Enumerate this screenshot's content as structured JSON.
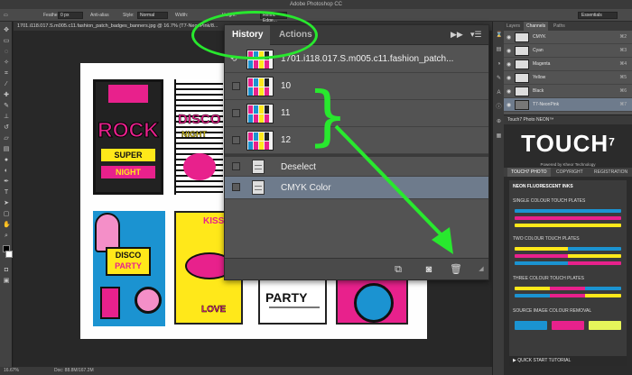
{
  "app": {
    "title": "Adobe Photoshop CC"
  },
  "options_bar": {
    "feather_label": "Feather:",
    "feather_value": "0 px",
    "antialias_label": "Anti-alias",
    "style_label": "Style:",
    "style_value": "Normal",
    "width_label": "Width:",
    "height_label": "Height:",
    "refine_edge_label": "Refine Edge...",
    "workspace": "Essentials"
  },
  "document": {
    "tab_title": "1701.i118.017.S.m005.c11.fashion_patch_badges_banners.jpg @ 16.7% (T7-NeonPink/8..."
  },
  "artwork": {
    "rock": "ROCK",
    "super": "SUPER",
    "night": "NIGHT",
    "disco": "DISCO",
    "disco_night": "NIGHT",
    "disco2": "DISCO",
    "party": "PARTY",
    "kiss": "KISS",
    "love": "LOVE",
    "party_big": "PARTY"
  },
  "history_panel": {
    "tabs": [
      {
        "label": "History"
      },
      {
        "label": "Actions"
      }
    ],
    "collapse_icon": "double-chevron-right-icon",
    "menu_icon": "panel-menu-icon",
    "rows": [
      {
        "label": "1701.i118.017.S.m005.c11.fashion_patch...",
        "kind": "snapshot"
      },
      {
        "label": "10",
        "kind": "snapshot"
      },
      {
        "label": "11",
        "kind": "snapshot"
      },
      {
        "label": "12",
        "kind": "snapshot"
      },
      {
        "label": "Deselect",
        "kind": "state"
      },
      {
        "label": "CMYK Color",
        "kind": "state",
        "selected": true
      }
    ],
    "footer_icons": [
      "new-document-icon",
      "camera-icon",
      "trash-icon"
    ]
  },
  "channels_panel": {
    "tabs": [
      {
        "label": "Layers"
      },
      {
        "label": "Channels"
      },
      {
        "label": "Paths"
      }
    ],
    "rows": [
      {
        "name": "CMYK",
        "key": "⌘2"
      },
      {
        "name": "Cyan",
        "key": "⌘3"
      },
      {
        "name": "Magenta",
        "key": "⌘4"
      },
      {
        "name": "Yellow",
        "key": "⌘5"
      },
      {
        "name": "Black",
        "key": "⌘6"
      },
      {
        "name": "T7-NeonPink",
        "key": "⌘7",
        "selected": true
      }
    ]
  },
  "touch_panel": {
    "header": "Touch7 Photo NEON™",
    "logo": "TOUCH",
    "logo_sup": "7",
    "logo_sub": "Powered by Kheor Technology",
    "tabs": [
      {
        "label": "TOUCH7 PHOTO"
      },
      {
        "label": "COPYRIGHT"
      },
      {
        "label": "REGISTRATION"
      }
    ],
    "section_main": "NEON FLUORESCENT INKS",
    "section_single": "SINGLE COLOUR TOUCH PLATES",
    "section_two": "TWO COLOUR TOUCH PLATES",
    "section_three": "THREE COLOUR TOUCH PLATES",
    "section_removal": "SOURCE IMAGE COLOUR REMOVAL",
    "quick_start": "QUICK START TUTORIAL"
  },
  "status_bar": {
    "zoom": "16.67%",
    "doc": "Doc: 88.8M/167.2M"
  },
  "colors": {
    "annotation": "#28e82e",
    "neon_pink": "#e8218c",
    "neon_yellow": "#ffe81a",
    "neon_blue": "#1b93d1",
    "selection": "#6e7b8c"
  }
}
